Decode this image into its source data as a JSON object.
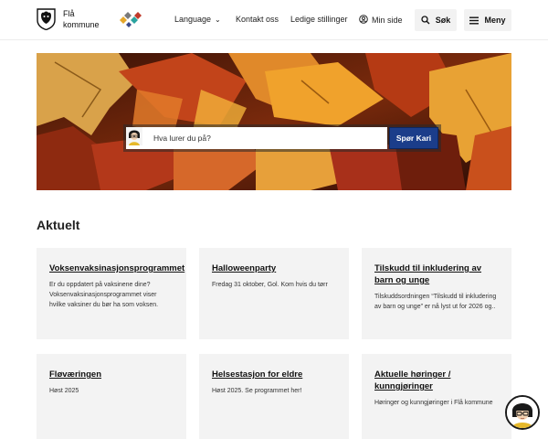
{
  "header": {
    "logo_line1": "Flå",
    "logo_line2": "kommune",
    "nav": {
      "language": "Language",
      "kontakt": "Kontakt oss",
      "stillinger": "Ledige stillinger",
      "minside": "Min side"
    },
    "search_label": "Søk",
    "menu_label": "Meny"
  },
  "hero": {
    "ask_placeholder": "Hva lurer du på?",
    "ask_button": "Spør Kari"
  },
  "aktuelt": {
    "title": "Aktuelt",
    "cards": [
      {
        "title": "Voksenvaksinasjonsprogrammet",
        "text": "Er du oppdatert på vaksinene dine? Voksenvaksinasjonsprogrammet viser hvilke vaksiner du bør ha som voksen."
      },
      {
        "title": "Halloweenparty",
        "text": "Fredag 31 oktober, Gol. Kom hvis du tørr"
      },
      {
        "title": "Tilskudd til inkludering av barn og unge",
        "text": "Tilskuddsordningen “Tilskudd til inkludering av barn og unge” er nå lyst ut for 2026 og.."
      },
      {
        "title": "Fløværingen",
        "text": "Høst 2025"
      },
      {
        "title": "Helsestasjon for eldre",
        "text": "Høst 2025. Se programmet her!"
      },
      {
        "title": "Aktuelle høringer / kunngjøringer",
        "text": "Høringer og kunngjøringer i Flå kommune"
      }
    ]
  },
  "colors": {
    "accent": "#1b3d8a",
    "card_bg": "#f3f3f3"
  },
  "icons": {
    "search": "search-icon",
    "menu": "menu-icon",
    "person": "person-icon",
    "chevron": "chevron-down-icon"
  }
}
